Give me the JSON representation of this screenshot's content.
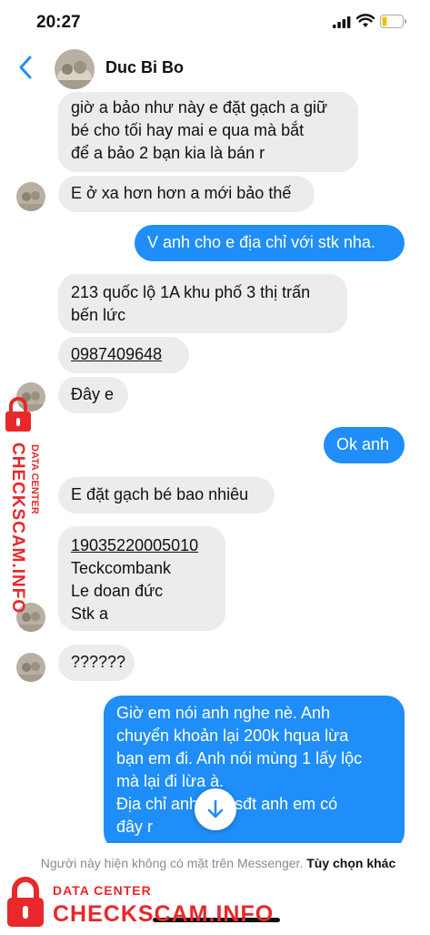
{
  "status_bar": {
    "time": "20:27"
  },
  "header": {
    "contact_name": "Duc Bi Bo"
  },
  "messages": {
    "m1": {
      "lines": [
        "giờ a bảo như này e đặt gạch a giữ",
        "bé cho tối hay mai e qua mà bắt",
        "để a bảo 2 bạn kia là bán r"
      ]
    },
    "m2": {
      "text": "E ở xa hơn hơn a mới bảo thế"
    },
    "m3": {
      "text": "V anh cho e địa chỉ với stk nha."
    },
    "m4": {
      "lines": [
        "213 quốc lộ 1A khu phố 3 thị trấn",
        "bến lức"
      ]
    },
    "m5": {
      "text": "0987409648"
    },
    "m6": {
      "text": "Đây e"
    },
    "m7": {
      "text": "Ok anh"
    },
    "m8": {
      "text": "E đặt gạch bé bao nhiêu"
    },
    "m9": {
      "lines": [
        "19035220005010",
        "Teckcombank",
        "Le doan đức",
        "Stk a"
      ]
    },
    "m10": {
      "text": "??????"
    },
    "m11": {
      "lines": [
        "Giờ em nói anh nghe nè. Anh",
        "chuyển khoản lại 200k hqua lừa",
        "bạn em đi. Anh nói mùng 1 lấy lộc",
        "mà lại đi lừa à.",
        "Địa chỉ anh",
        "sđt anh em có",
        "đây r"
      ]
    }
  },
  "footer": {
    "notice": "Người này hiện không có mặt trên Messenger.",
    "option": "Tùy chọn khác"
  },
  "watermark": {
    "side_big": "CHECKSCAM.INFO",
    "side_small": "DATA CENTER",
    "bottom_small": "DATA CENTER",
    "bottom_big": "CHECKSCAM.INFO"
  },
  "colors": {
    "accent": "#1f8ef8",
    "incoming_bubble": "#ececee",
    "watermark": "#e8282a"
  },
  "icons": [
    "back-chevron-icon",
    "signal-icon",
    "wifi-icon",
    "battery-icon",
    "scroll-down-arrow-icon",
    "lock-icon"
  ]
}
